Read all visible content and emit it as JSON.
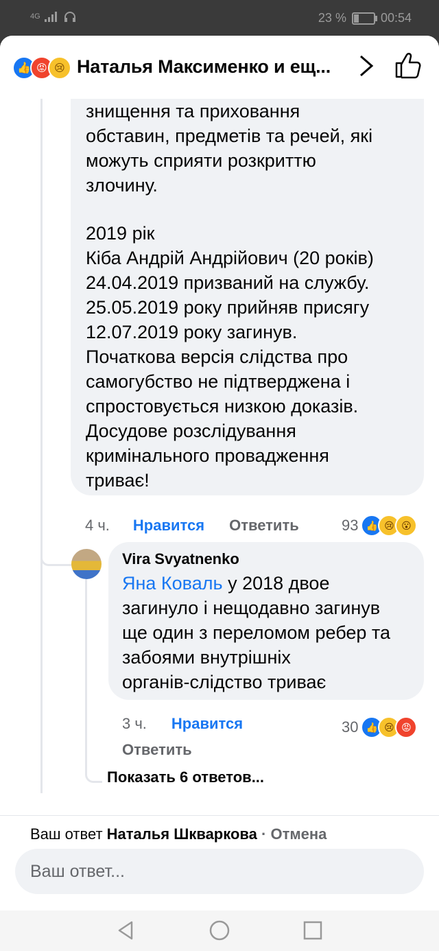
{
  "status_bar": {
    "network": "4G",
    "battery_percent": "23 %",
    "time": "00:54"
  },
  "header": {
    "title": "Наталья Максименко и ещ...",
    "reaction_icons": [
      "like-icon",
      "angry-icon",
      "sad-icon"
    ]
  },
  "comment1": {
    "lines": [
      "знищення та приховання",
      "обставин, предметів та речей, які",
      "можуть сприяти розкриттю",
      "злочину.",
      "",
      "2019 рік",
      "Кіба Андрій Андрійович (20 років)",
      "24.04.2019 призваний на службу.",
      "25.05.2019 року прийняв присягу",
      "12.07.2019 року загинув.",
      "Початкова версія слідства про",
      "самогубство не підтверджена і",
      "спростовується низкою доказів.",
      "Досудове розслідування",
      "кримінального провадження",
      "триває!"
    ],
    "time": "4 ч.",
    "like_label": "Нравится",
    "reply_label": "Ответить",
    "reaction_count": "93",
    "reaction_icons": [
      "like-icon",
      "sad-icon",
      "wow-icon"
    ]
  },
  "reply1": {
    "author": "Vira Svyatnenko",
    "mention": "Яна Коваль",
    "first_line_rest": " у 2018 двое",
    "lines": [
      "загинуло і нещодавно загинув",
      "ще один з переломом ребер та",
      "забоями внутрішніх",
      "органів-слідство триває"
    ],
    "time": "3 ч.",
    "like_label": "Нравится",
    "reply_label": "Ответить",
    "reaction_count": "30",
    "reaction_icons": [
      "like-icon",
      "sad-icon",
      "angry-icon"
    ]
  },
  "show_more": "Показать 6 ответов...",
  "composer": {
    "reply_prefix": "Ваш ответ ",
    "reply_to_name": "Наталья Шкваркова",
    "separator": " · ",
    "cancel_label": "Отмена",
    "input_placeholder": "Ваш ответ..."
  },
  "colors": {
    "accent": "#1877f2",
    "bubble": "#f0f2f5",
    "secondary_text": "#65676b"
  }
}
